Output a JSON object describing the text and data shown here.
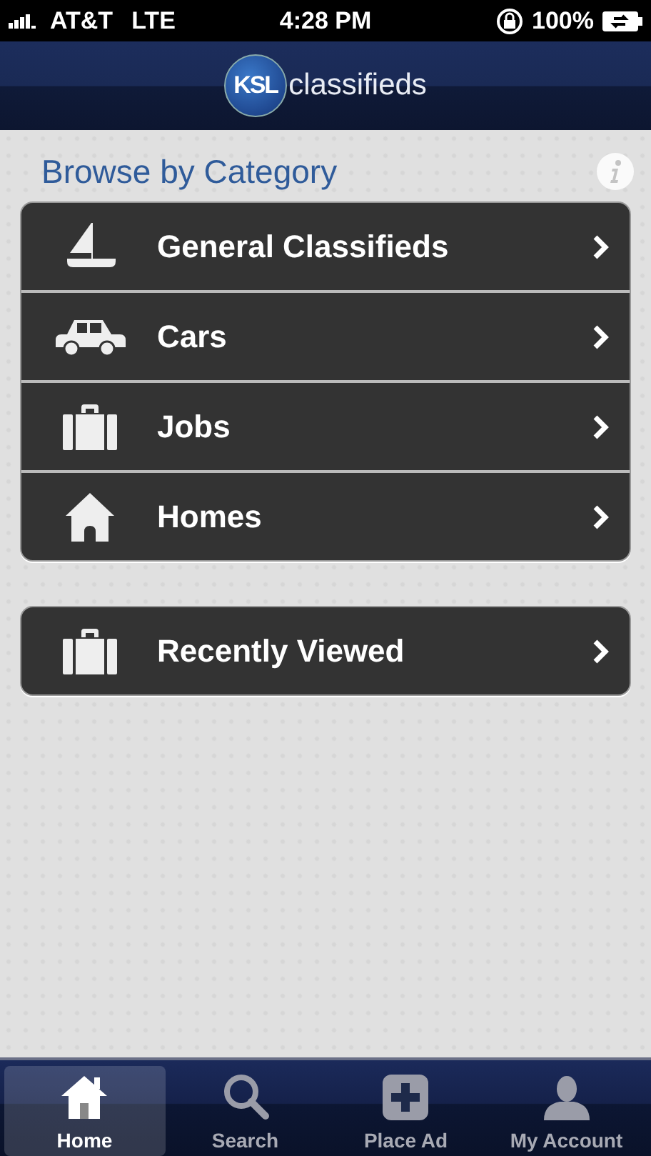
{
  "status_bar": {
    "carrier": "AT&T",
    "network": "LTE",
    "time": "4:28 PM",
    "battery": "100%"
  },
  "nav_bar": {
    "logo_badge": "KSL",
    "logo_text": "classifieds"
  },
  "heading": "Browse by Category",
  "groups": [
    {
      "items": [
        {
          "label": "General Classifieds",
          "kind": "boat"
        },
        {
          "label": "Cars",
          "kind": "car"
        },
        {
          "label": "Jobs",
          "kind": "briefcase"
        },
        {
          "label": "Homes",
          "kind": "house"
        }
      ]
    },
    {
      "items": [
        {
          "label": "Recently Viewed",
          "kind": "briefcase"
        }
      ]
    }
  ],
  "tabs": [
    {
      "label": "Home",
      "kind": "home",
      "selected": true
    },
    {
      "label": "Search",
      "kind": "search",
      "selected": false
    },
    {
      "label": "Place Ad",
      "kind": "plus",
      "selected": false
    },
    {
      "label": "My Account",
      "kind": "person",
      "selected": false
    }
  ]
}
